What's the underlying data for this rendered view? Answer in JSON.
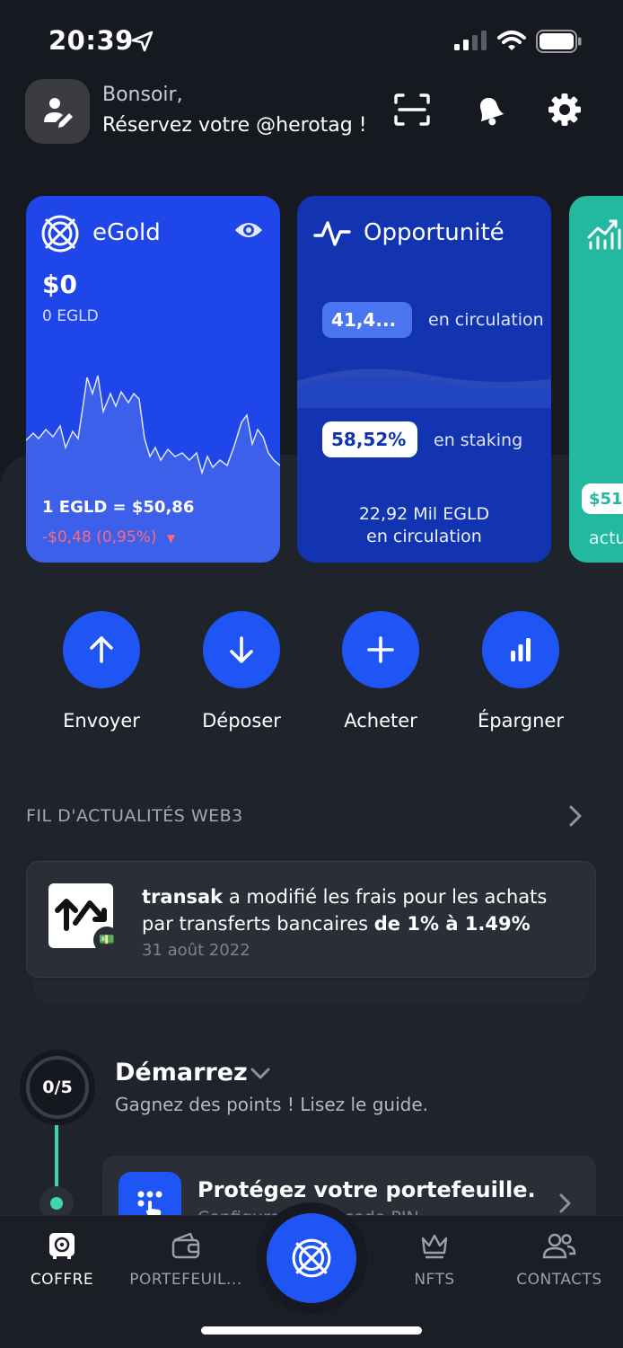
{
  "status_bar": {
    "time": "20:39"
  },
  "header": {
    "greeting": "Bonsoir,",
    "subtitle": "Réservez votre @herotag !"
  },
  "cards": {
    "egold": {
      "title": "eGold",
      "balance_usd": "$0",
      "balance_egld": "0 EGLD",
      "rate": "1 EGLD = $50,86",
      "change": "-$0,48 (0,95%)",
      "change_color": "#ff6a7a",
      "color": "#1e46e8"
    },
    "opportunity": {
      "title": "Opportunité",
      "circulation_value": "41,4...",
      "circulation_label": "en circulation",
      "staking_value": "58,52%",
      "staking_label": "en staking",
      "footer_line1": "22,92 Mil EGLD",
      "footer_line2": "en circulation",
      "color": "#1234b0"
    },
    "third": {
      "value": "$51",
      "label": "actu",
      "color": "#23b8a0"
    }
  },
  "actions": [
    {
      "label": "Envoyer",
      "icon": "arrow-up-icon"
    },
    {
      "label": "Déposer",
      "icon": "arrow-down-icon"
    },
    {
      "label": "Acheter",
      "icon": "plus-icon"
    },
    {
      "label": "Épargner",
      "icon": "bar-chart-icon"
    }
  ],
  "news": {
    "section_title": "FIL D'ACTUALITÉS WEB3",
    "item": {
      "source": "transak",
      "text_mid": " a modifié les frais pour les achats par transferts bancaires ",
      "text_bold": "de 1% à 1.49%",
      "date": "31 août 2022"
    }
  },
  "getting_started": {
    "progress": "0/5",
    "title": "Démarrez",
    "subtitle": "Gagnez des points ! Lisez le guide.",
    "task_title": "Protégez votre portefeuille.",
    "task_subtitle": "Configurez votre code PIN"
  },
  "tabbar": {
    "tabs": [
      {
        "label": "COFFRE",
        "icon": "safe-icon",
        "active": true
      },
      {
        "label": "PORTEFEUIL...",
        "icon": "wallet-icon"
      },
      {
        "label": "NFTS",
        "icon": "crown-icon"
      },
      {
        "label": "CONTACTS",
        "icon": "contacts-icon"
      }
    ]
  },
  "accent_color": "#1f54f5"
}
